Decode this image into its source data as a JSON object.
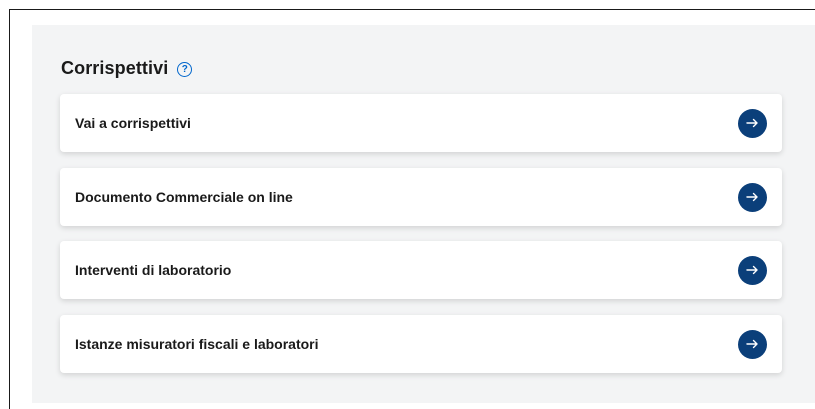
{
  "section": {
    "title": "Corrispettivi",
    "help_icon": "question-circle-icon",
    "help_glyph": "?"
  },
  "cards": [
    {
      "label": "Vai a corrispettivi",
      "icon": "arrow-right-icon"
    },
    {
      "label": "Documento Commerciale on line",
      "icon": "arrow-right-icon"
    },
    {
      "label": "Interventi di laboratorio",
      "icon": "arrow-right-icon"
    },
    {
      "label": "Istanze misuratori fiscali e laboratori",
      "icon": "arrow-right-icon"
    }
  ],
  "colors": {
    "accent": "#0b3f7a",
    "help": "#0066cc",
    "panel_bg": "#f3f4f5"
  }
}
